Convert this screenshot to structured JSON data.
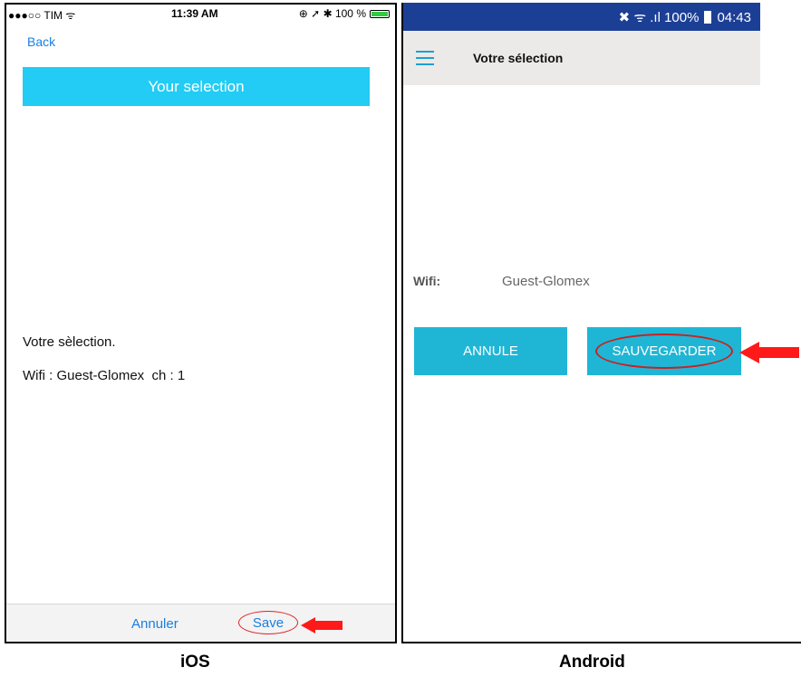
{
  "ios": {
    "status": {
      "carrier": "●●●○○ TIM ᯤ",
      "time": "11:39 AM",
      "indicators": "⊕ ➚ ✱ 100 %"
    },
    "nav": {
      "back_label": "Back"
    },
    "header_title": "Your selection",
    "body": {
      "line1": "Votre sèlection.",
      "line2": "Wifi : Guest-Glomex  ch : 1"
    },
    "toolbar": {
      "cancel_label": "Annuler",
      "save_label": "Save"
    }
  },
  "android": {
    "status": {
      "indicators": "✖ ᯤ .ıl 100%",
      "time": "04:43"
    },
    "appbar": {
      "title": "Votre sélection"
    },
    "wifi": {
      "label": "Wifi:",
      "value": "Guest-Glomex"
    },
    "buttons": {
      "cancel_label": "ANNULE",
      "save_label": "SAUVEGARDER"
    }
  },
  "captions": {
    "left": "iOS",
    "right": "Android"
  },
  "colors": {
    "ios_accent": "#22ccf4",
    "android_accent": "#1fb6d6",
    "android_status": "#1c3f96",
    "highlight": "#e02020"
  }
}
